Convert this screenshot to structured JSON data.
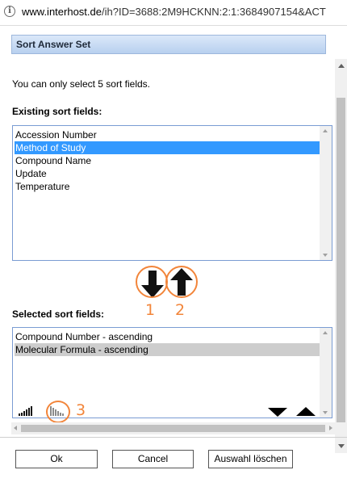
{
  "browser": {
    "url_domain": "www.interhost.de",
    "url_rest": "/ih?ID=3688:2M9HCKNN:2:1:3684907154&ACT"
  },
  "dialog": {
    "title": "Sort Answer Set",
    "hint": "You can only select 5 sort fields.",
    "existing_label": "Existing sort fields:",
    "existing_fields": [
      "Accession Number",
      "Method of Study",
      "Compound Name",
      "Update",
      "Temperature"
    ],
    "existing_selected_index": 1,
    "selected_label": "Selected sort fields:",
    "selected_fields": [
      "Compound Number - ascending",
      "Molecular Formula - ascending"
    ],
    "selected_highlight_index": 1
  },
  "annotations": [
    "1",
    "2",
    "3"
  ],
  "buttons": {
    "ok": "Ok",
    "cancel": "Cancel",
    "clear": "Auswahl löschen"
  },
  "colors": {
    "accent": "#f2853a",
    "selection": "#3399ff",
    "title_bar": "#c6daf3"
  }
}
